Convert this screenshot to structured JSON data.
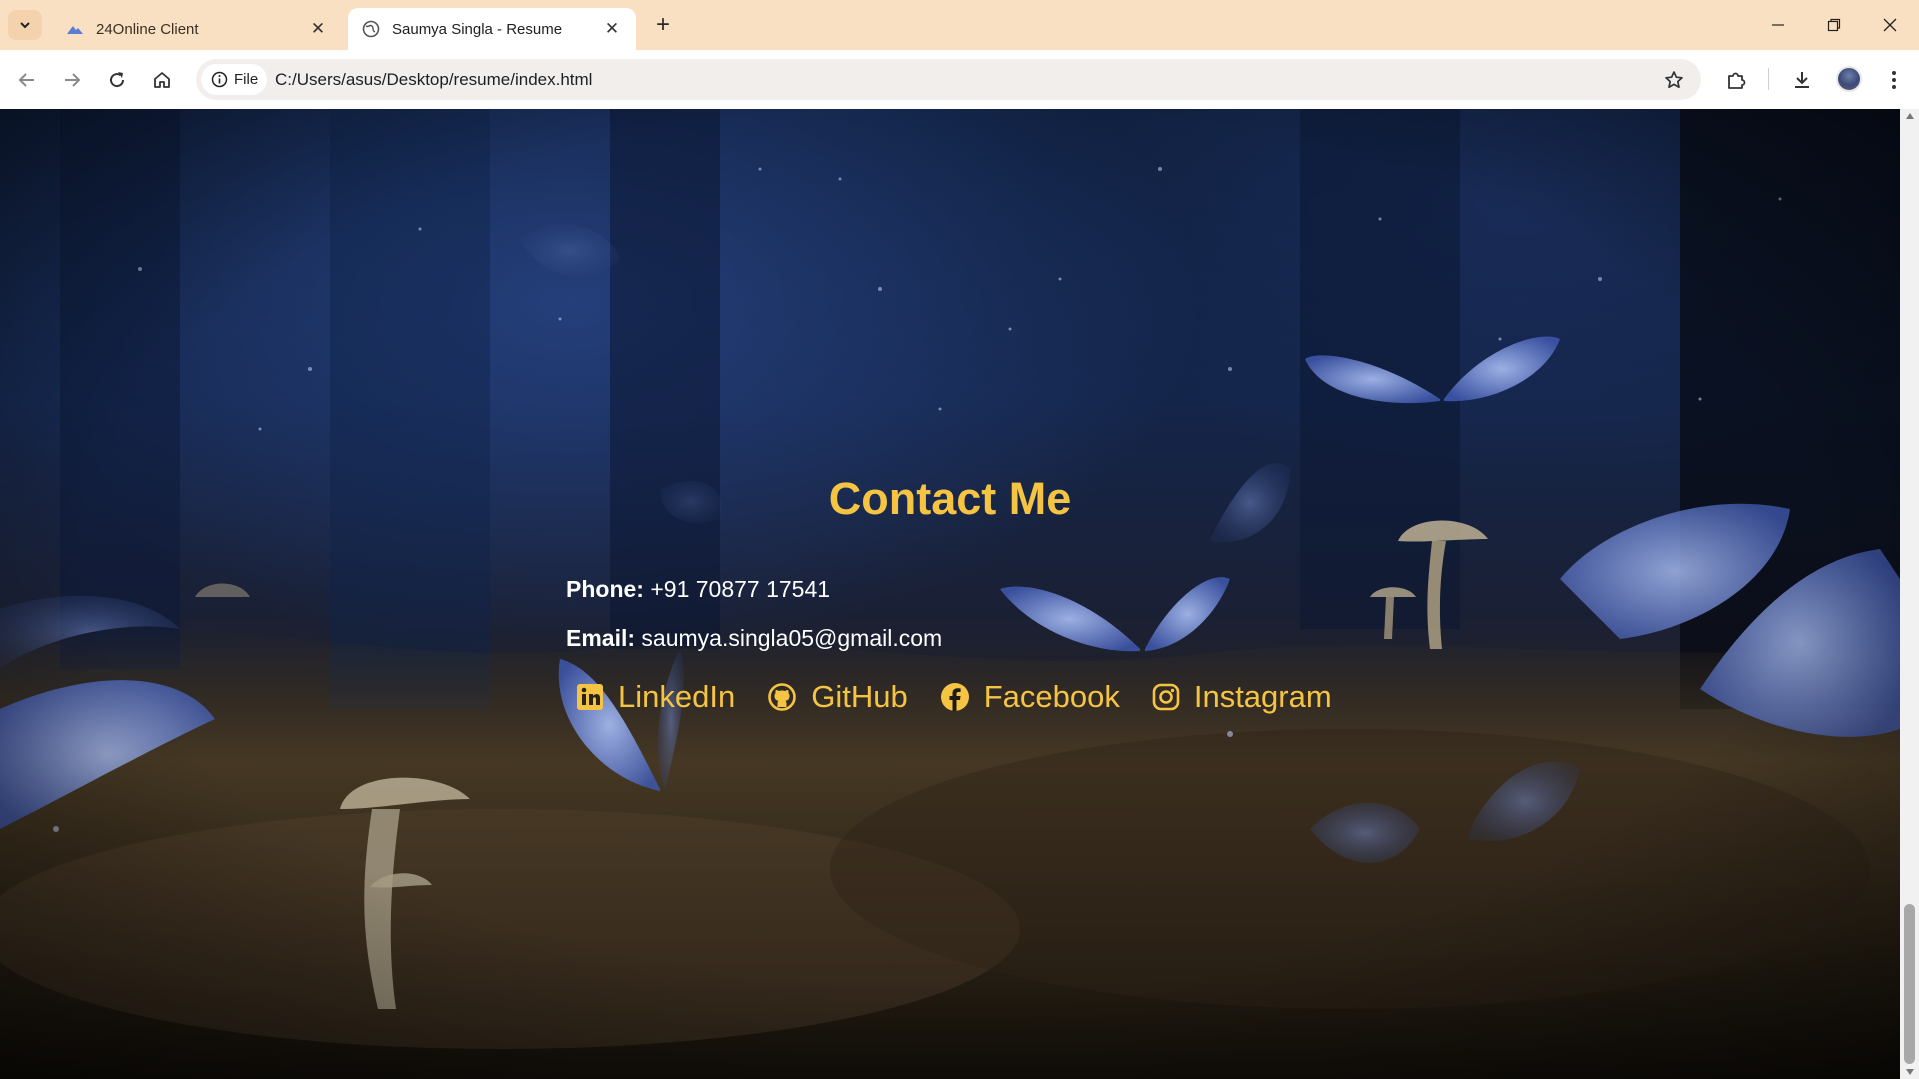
{
  "browser": {
    "tabs": [
      {
        "title": "24Online Client",
        "favicon": "mountain-icon",
        "active": false
      },
      {
        "title": "Saumya Singla - Resume",
        "favicon": "globe-icon",
        "active": true
      }
    ],
    "address": {
      "chip_label": "File",
      "url": "C:/Users/asus/Desktop/resume/index.html"
    }
  },
  "contact": {
    "heading": "Contact Me",
    "phone_label": "Phone:",
    "phone_value": "+91 70877 17541",
    "email_label": "Email:",
    "email_value": "saumya.singla05@gmail.com",
    "socials": [
      {
        "label": "LinkedIn",
        "icon": "linkedin-icon"
      },
      {
        "label": "GitHub",
        "icon": "github-icon"
      },
      {
        "label": "Facebook",
        "icon": "facebook-icon"
      },
      {
        "label": "Instagram",
        "icon": "instagram-icon"
      }
    ]
  },
  "colors": {
    "accent": "#f6c443",
    "tabstrip": "#f9e0c2",
    "text": "#ffffff"
  }
}
